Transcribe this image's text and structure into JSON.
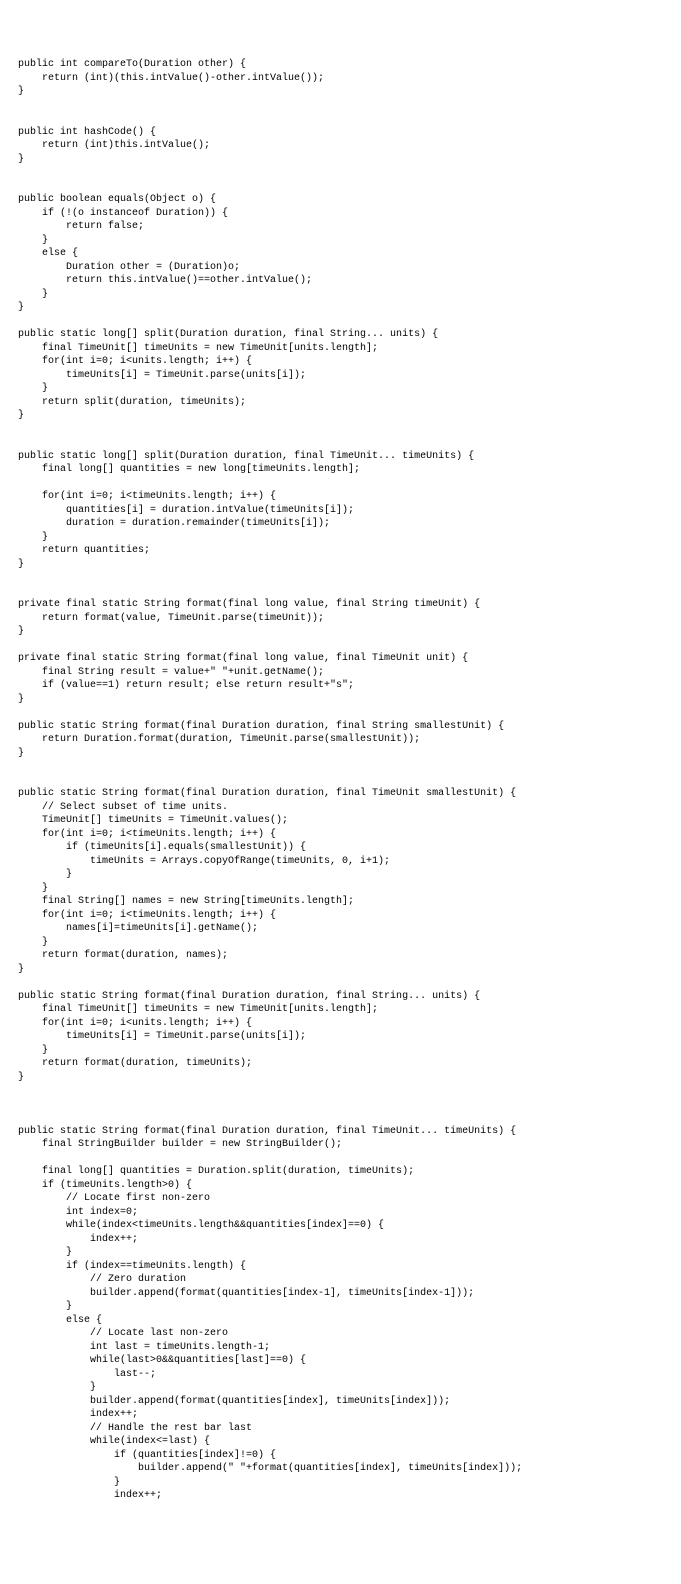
{
  "code": "public int compareTo(Duration other) {\n    return (int)(this.intValue()-other.intValue());\n}\n\n\npublic int hashCode() {\n    return (int)this.intValue();\n}\n\n\npublic boolean equals(Object o) {\n    if (!(o instanceof Duration)) {\n        return false;\n    }\n    else {\n        Duration other = (Duration)o;\n        return this.intValue()==other.intValue();\n    }\n}\n\npublic static long[] split(Duration duration, final String... units) {\n    final TimeUnit[] timeUnits = new TimeUnit[units.length];\n    for(int i=0; i<units.length; i++) {\n        timeUnits[i] = TimeUnit.parse(units[i]);\n    }\n    return split(duration, timeUnits);\n}\n\n\npublic static long[] split(Duration duration, final TimeUnit... timeUnits) {\n    final long[] quantities = new long[timeUnits.length];\n\n    for(int i=0; i<timeUnits.length; i++) {\n        quantities[i] = duration.intValue(timeUnits[i]);\n        duration = duration.remainder(timeUnits[i]);\n    }\n    return quantities;\n}\n\n\nprivate final static String format(final long value, final String timeUnit) {\n    return format(value, TimeUnit.parse(timeUnit));\n}\n\nprivate final static String format(final long value, final TimeUnit unit) {\n    final String result = value+\" \"+unit.getName();\n    if (value==1) return result; else return result+\"s\";\n}\n\npublic static String format(final Duration duration, final String smallestUnit) {\n    return Duration.format(duration, TimeUnit.parse(smallestUnit));\n}\n\n\npublic static String format(final Duration duration, final TimeUnit smallestUnit) {\n    // Select subset of time units.\n    TimeUnit[] timeUnits = TimeUnit.values();\n    for(int i=0; i<timeUnits.length; i++) {\n        if (timeUnits[i].equals(smallestUnit)) {\n            timeUnits = Arrays.copyOfRange(timeUnits, 0, i+1);\n        }\n    }\n    final String[] names = new String[timeUnits.length];\n    for(int i=0; i<timeUnits.length; i++) {\n        names[i]=timeUnits[i].getName();\n    }\n    return format(duration, names);\n}\n\npublic static String format(final Duration duration, final String... units) {\n    final TimeUnit[] timeUnits = new TimeUnit[units.length];\n    for(int i=0; i<units.length; i++) {\n        timeUnits[i] = TimeUnit.parse(units[i]);\n    }\n    return format(duration, timeUnits);\n}\n\n\n\npublic static String format(final Duration duration, final TimeUnit... timeUnits) {\n    final StringBuilder builder = new StringBuilder();\n\n    final long[] quantities = Duration.split(duration, timeUnits);\n    if (timeUnits.length>0) {\n        // Locate first non-zero\n        int index=0;\n        while(index<timeUnits.length&&quantities[index]==0) {\n            index++;\n        }\n        if (index==timeUnits.length) {\n            // Zero duration\n            builder.append(format(quantities[index-1], timeUnits[index-1]));\n        }\n        else {\n            // Locate last non-zero\n            int last = timeUnits.length-1;\n            while(last>0&&quantities[last]==0) {\n                last--;\n            }\n            builder.append(format(quantities[index], timeUnits[index]));\n            index++;\n            // Handle the rest bar last\n            while(index<=last) {\n                if (quantities[index]!=0) {\n                    builder.append(\" \"+format(quantities[index], timeUnits[index]));\n                }\n                index++;"
}
